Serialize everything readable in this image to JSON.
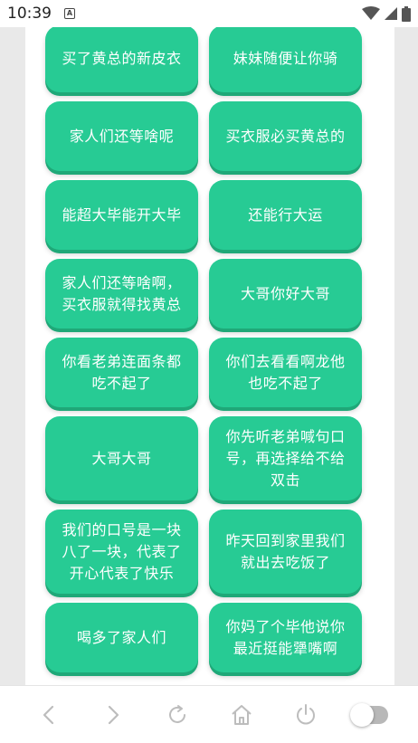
{
  "status_bar": {
    "time": "10:39",
    "notification_icon": "a-icon",
    "right_icons": [
      "wifi-icon",
      "cell-signal-icon",
      "battery-icon"
    ]
  },
  "colors": {
    "button_bg": "#27cb94",
    "button_shadow": "#1fa878",
    "button_text": "#ffffff",
    "nav_icon": "#bdbdbd"
  },
  "phrases": [
    "买了黄总的新皮衣",
    "妹妹随便让你骑",
    "家人们还等啥呢",
    "买衣服必买黄总的",
    "能超大毕能开大毕",
    "还能行大运",
    "家人们还等啥啊，买衣服就得找黄总",
    "大哥你好大哥",
    "你看老弟连面条都吃不起了",
    "你们去看看啊龙他也吃不起了",
    "大哥大哥",
    "你先听老弟喊句口号，再选择给不给双击",
    "我们的口号是一块八了一块，代表了开心代表了快乐",
    "昨天回到家里我们就出去吃饭了",
    "喝多了家人们",
    "你妈了个毕他说你最近挺能犟嘴啊"
  ],
  "nav_bar": {
    "items": [
      "back-icon",
      "forward-icon",
      "refresh-icon",
      "home-icon",
      "power-icon",
      "toggle-switch"
    ]
  }
}
